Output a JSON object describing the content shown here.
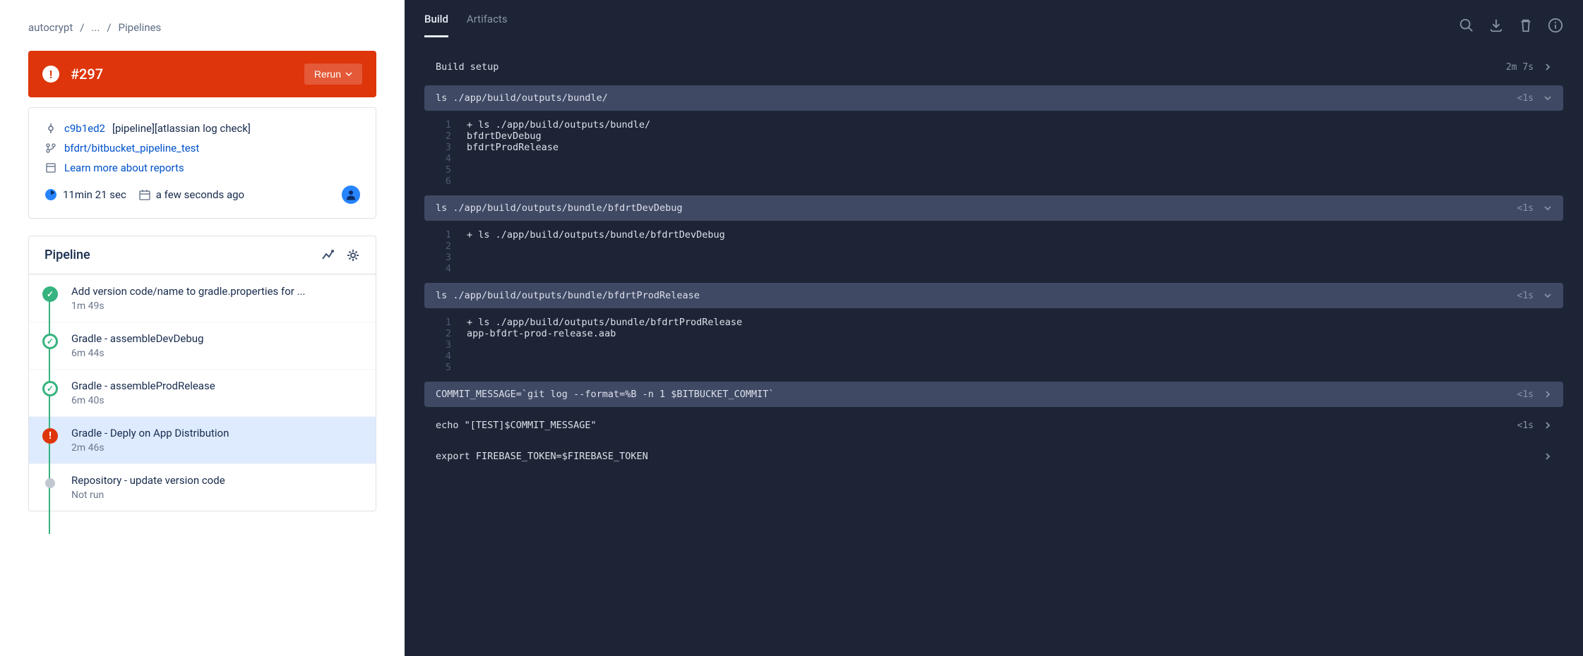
{
  "breadcrumb": {
    "project": "autocrypt",
    "ellipsis": "...",
    "page": "Pipelines"
  },
  "status": {
    "title": "#297",
    "rerun_label": "Rerun"
  },
  "commit": {
    "hash": "c9b1ed2",
    "message": "[pipeline][atlassian log check]",
    "branch": "bfdrt/bitbucket_pipeline_test",
    "reports_label": "Learn more about reports",
    "duration": "11min 21 sec",
    "age": "a few seconds ago"
  },
  "pipeline": {
    "title": "Pipeline",
    "steps": [
      {
        "name": "Add version code/name to gradle.properties for ...",
        "time_label": "1m 49s",
        "status": "success"
      },
      {
        "name": "Gradle - assembleDevDebug",
        "time_label": "6m 44s",
        "status": "success-ring"
      },
      {
        "name": "Gradle - assembleProdRelease",
        "time_label": "6m 40s",
        "status": "success-ring"
      },
      {
        "name": "Gradle - Deply on App Distribution",
        "time_label": "2m 46s",
        "status": "failed"
      },
      {
        "name": "Repository - update version code",
        "time_label": "Not run",
        "status": "notrun"
      }
    ]
  },
  "tabs": {
    "build": "Build",
    "artifacts": "Artifacts"
  },
  "log": {
    "setup_label": "Build setup",
    "setup_time": "2m 7s",
    "sections": [
      {
        "cmd": "ls ./app/build/outputs/bundle/",
        "time": "<1s",
        "expanded": true,
        "lines": [
          {
            "n": "1",
            "t": "+ ls ./app/build/outputs/bundle/"
          },
          {
            "n": "2",
            "t": "bfdrtDevDebug"
          },
          {
            "n": "3",
            "t": "bfdrtProdRelease"
          },
          {
            "n": "4",
            "t": ""
          },
          {
            "n": "5",
            "t": ""
          },
          {
            "n": "6",
            "t": ""
          }
        ]
      },
      {
        "cmd": "ls ./app/build/outputs/bundle/bfdrtDevDebug",
        "time": "<1s",
        "expanded": true,
        "lines": [
          {
            "n": "1",
            "t": "+ ls ./app/build/outputs/bundle/bfdrtDevDebug"
          },
          {
            "n": "2",
            "t": ""
          },
          {
            "n": "3",
            "t": ""
          },
          {
            "n": "4",
            "t": ""
          }
        ]
      },
      {
        "cmd": "ls ./app/build/outputs/bundle/bfdrtProdRelease",
        "time": "<1s",
        "expanded": true,
        "lines": [
          {
            "n": "1",
            "t": "+ ls ./app/build/outputs/bundle/bfdrtProdRelease"
          },
          {
            "n": "2",
            "t": "app-bfdrt-prod-release.aab"
          },
          {
            "n": "3",
            "t": ""
          },
          {
            "n": "4",
            "t": ""
          },
          {
            "n": "5",
            "t": ""
          }
        ]
      },
      {
        "cmd": "COMMIT_MESSAGE=`git log --format=%B -n 1 $BITBUCKET_COMMIT`",
        "time": "<1s",
        "expanded": false
      },
      {
        "cmd": "echo \"[TEST]$COMMIT_MESSAGE\"",
        "time": "<1s",
        "expanded": false,
        "plain": true
      },
      {
        "cmd": "export FIREBASE_TOKEN=$FIREBASE_TOKEN",
        "time": "",
        "expanded": false,
        "plain": true
      }
    ]
  }
}
